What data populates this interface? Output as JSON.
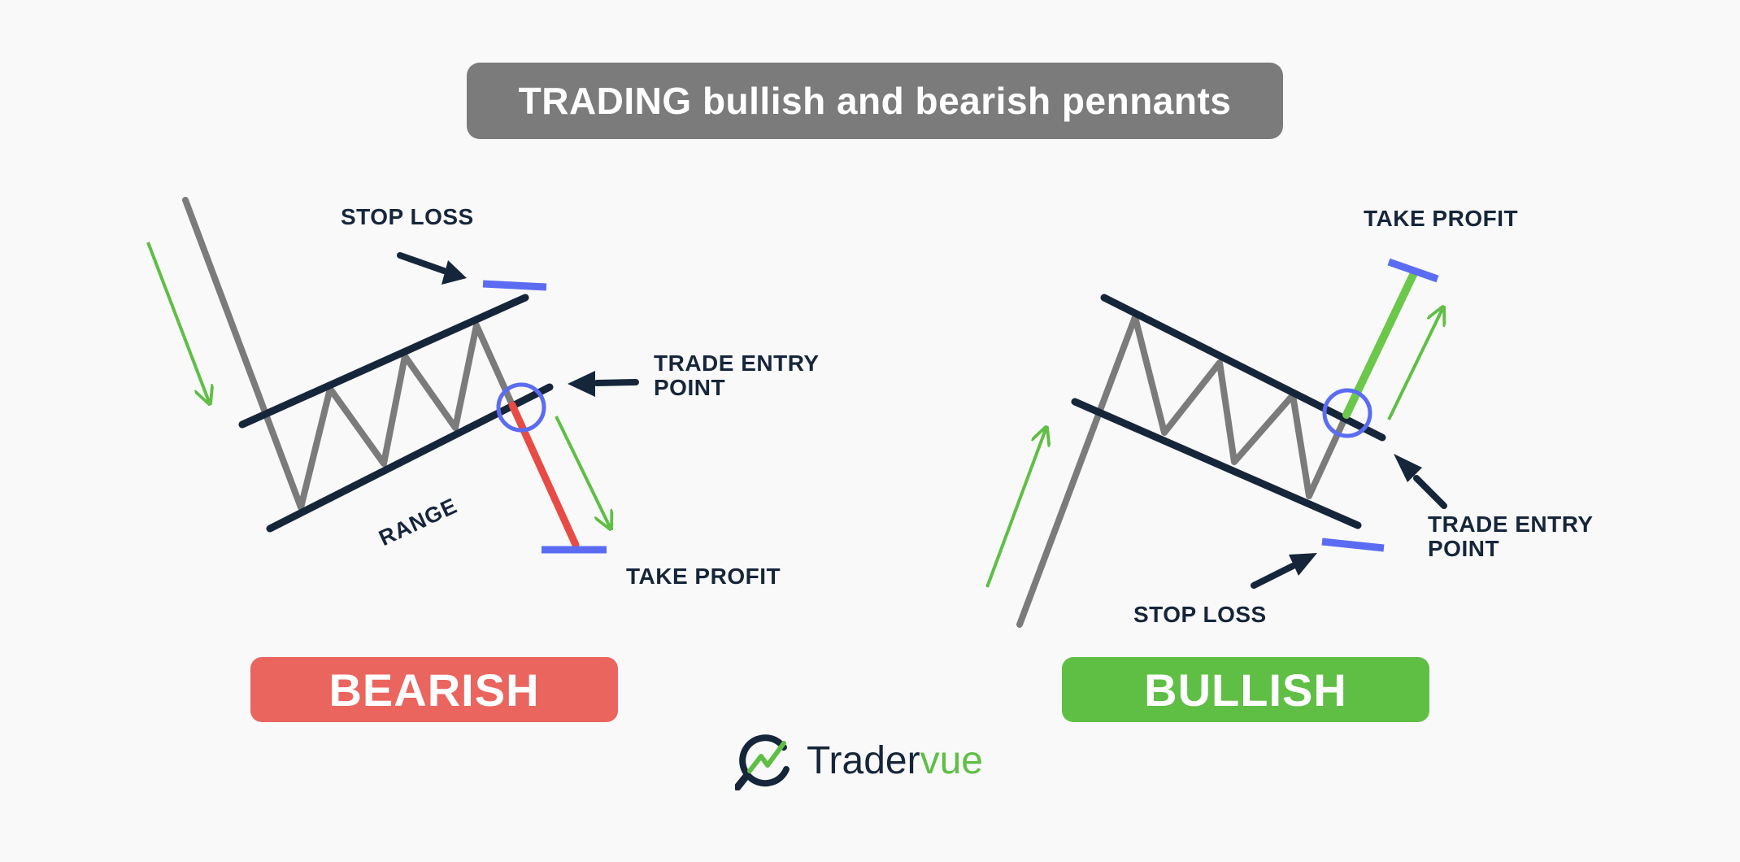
{
  "title": "TRADING bullish and bearish pennants",
  "bearish": {
    "stop_loss": "STOP LOSS",
    "trade_entry_line1": "TRADE ENTRY",
    "trade_entry_line2": "POINT",
    "range": "RANGE",
    "take_profit": "TAKE PROFIT",
    "badge": "BEARISH"
  },
  "bullish": {
    "take_profit": "TAKE PROFIT",
    "trade_entry_line1": "TRADE ENTRY",
    "trade_entry_line2": "POINT",
    "stop_loss": "STOP LOSS",
    "badge": "BULLISH"
  },
  "logo": {
    "name_part1": "Trader",
    "name_part2": "vue"
  },
  "colors": {
    "title_bg": "#7b7b7b",
    "bearish": "#eb655f",
    "bullish": "#5fbf45",
    "level_marker": "#5b6cf2",
    "trend_line": "#16263a",
    "price_line": "#7b7b7b"
  }
}
